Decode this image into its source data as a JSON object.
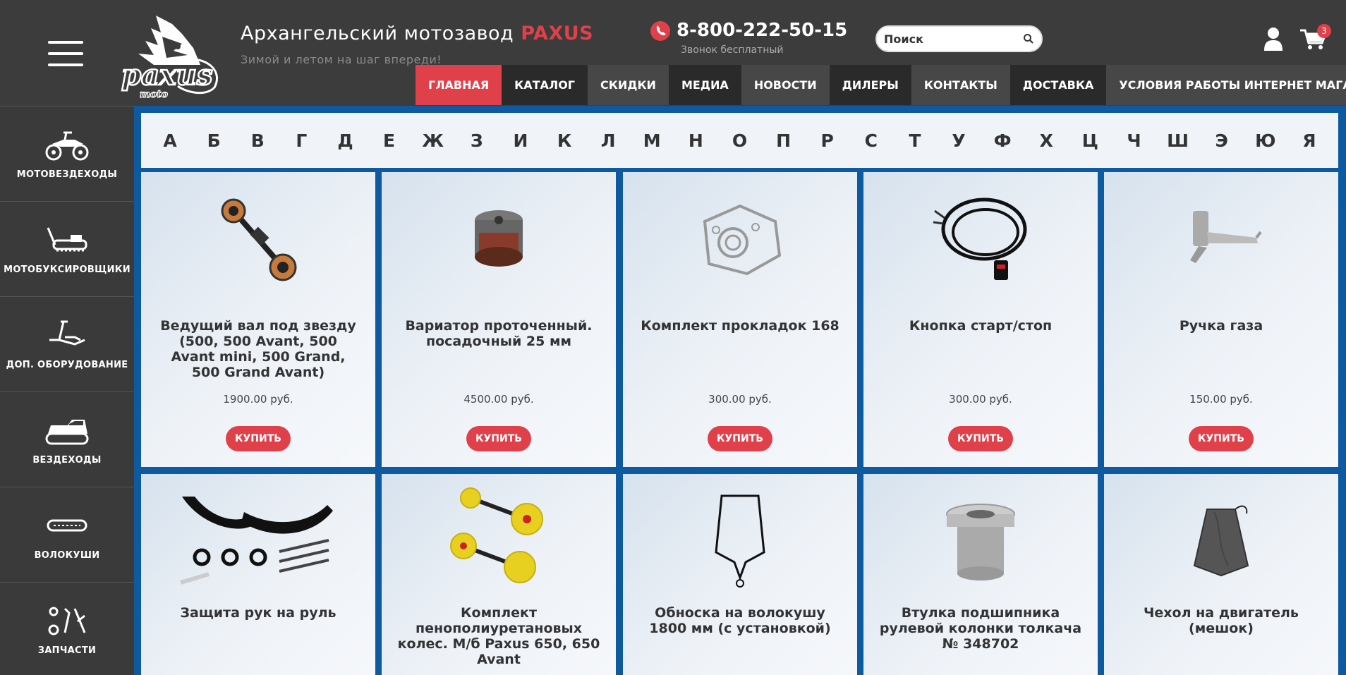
{
  "header": {
    "brand_name": "Архангельский мотозавод",
    "brand_accent": "PAXUS",
    "tagline": "Зимой и летом на шаг впереди!",
    "phone": "8-800-222-50-15",
    "phone_note": "Звонок бесплатный",
    "search_placeholder": "Поиск",
    "cart_count": "3",
    "logo_text": "paxus moto"
  },
  "nav": [
    {
      "label": "ГЛАВНАЯ",
      "state": "active"
    },
    {
      "label": "КАТАЛОГ",
      "state": "dark"
    },
    {
      "label": "СКИДКИ",
      "state": "mid"
    },
    {
      "label": "МЕДИА",
      "state": "dark"
    },
    {
      "label": "НОВОСТИ",
      "state": "mid"
    },
    {
      "label": "ДИЛЕРЫ",
      "state": "dark"
    },
    {
      "label": "КОНТАКТЫ",
      "state": "mid"
    },
    {
      "label": "ДОСТАВКА",
      "state": "dark"
    },
    {
      "label": "УСЛОВИЯ РАБОТЫ ИНТЕРНЕТ МАГАЗИНА",
      "state": "mid"
    }
  ],
  "sidebar": [
    {
      "label": "МОТОВЕЗДЕХОДЫ",
      "icon": "atv-icon"
    },
    {
      "label": "МОТОБУКСИРОВЩИКИ",
      "icon": "snow-towing-motor-icon"
    },
    {
      "label": "ДОП. ОБОРУДОВАНИЕ",
      "icon": "plow-icon"
    },
    {
      "label": "ВЕЗДЕХОДЫ",
      "icon": "tracked-vehicle-icon"
    },
    {
      "label": "ВОЛОКУШИ",
      "icon": "sled-icon"
    },
    {
      "label": "ЗАПЧАСТИ",
      "icon": "wrench-parts-icon"
    }
  ],
  "alphabet": [
    "А",
    "Б",
    "В",
    "Г",
    "Д",
    "Е",
    "Ж",
    "З",
    "И",
    "К",
    "Л",
    "М",
    "Н",
    "О",
    "П",
    "Р",
    "С",
    "Т",
    "У",
    "Ф",
    "Х",
    "Ц",
    "Ч",
    "Ш",
    "Э",
    "Ю",
    "Я"
  ],
  "products": [
    {
      "name": "Ведущий вал под звезду (500, 500 Avant, 500 Avant mini, 500 Grand, 500 Grand Avant)",
      "price": "1900.00 руб.",
      "button": "КУПИТЬ",
      "icon": "drive-shaft-icon"
    },
    {
      "name": "Вариатор проточенный. посадочный 25 мм",
      "price": "4500.00 руб.",
      "button": "КУПИТЬ",
      "icon": "variator-icon"
    },
    {
      "name": "Комплект прокладок 168",
      "price": "300.00 руб.",
      "button": "КУПИТЬ",
      "icon": "gasket-set-icon"
    },
    {
      "name": "Кнопка старт/стоп",
      "price": "300.00 руб.",
      "button": "КУПИТЬ",
      "icon": "start-stop-button-icon"
    },
    {
      "name": "Ручка газа",
      "price": "150.00 руб.",
      "button": "КУПИТЬ",
      "icon": "throttle-handle-icon"
    },
    {
      "name": "Защита рук на руль",
      "icon": "hand-guard-icon"
    },
    {
      "name": "Комплект пенополиуретановых колес. М/б Paxus 650, 650 Avant",
      "icon": "wheels-set-icon"
    },
    {
      "name": "Обноска на волокушу 1800 мм (с установкой)",
      "icon": "sled-hitch-icon"
    },
    {
      "name": "Втулка подшипника рулевой колонки толкача № 348702",
      "icon": "bushing-icon"
    },
    {
      "name": "Чехол на двигатель (мешок)",
      "icon": "engine-cover-icon"
    }
  ]
}
